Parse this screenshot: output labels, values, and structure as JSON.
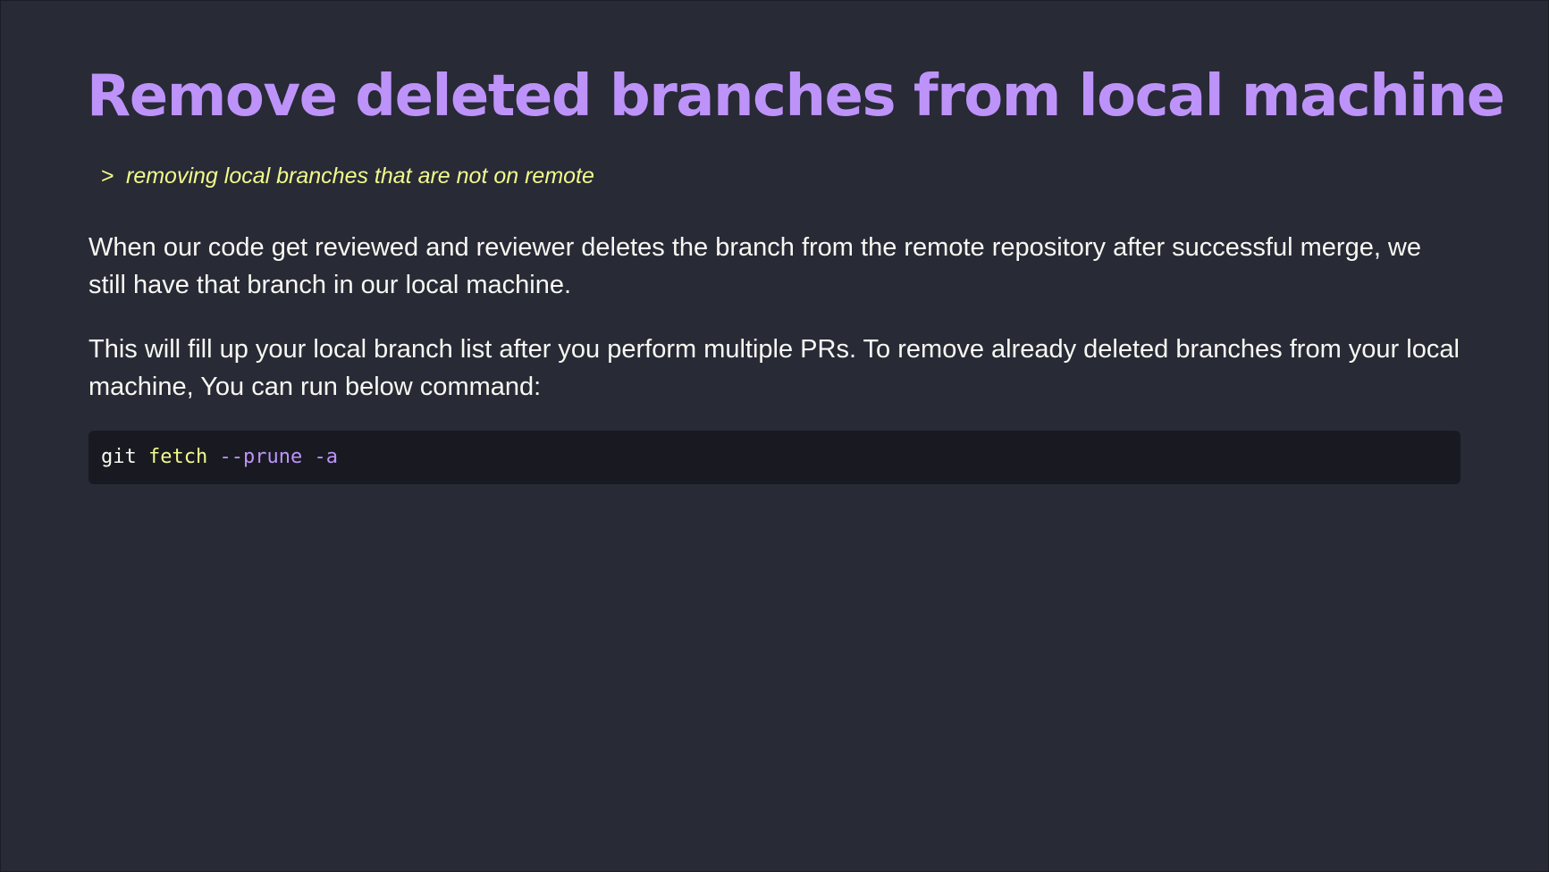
{
  "article": {
    "title": "Remove deleted branches from local machine",
    "subtitle_marker": ">",
    "subtitle": "removing local branches that are not on remote",
    "paragraphs": [
      "When our code get reviewed and reviewer deletes the branch from the remote repository after successful merge, we still have that branch in our local machine.",
      "This will fill up your local branch list after you perform multiple PRs. To remove already deleted branches from your local machine, You can run below command:"
    ],
    "code": {
      "command": "git",
      "subcommand": "fetch",
      "flags": "--prune -a"
    }
  },
  "colors": {
    "background": "#282a36",
    "title": "#bd93f9",
    "subtitle": "#f1fa8c",
    "text": "#f8f8f2",
    "code_background": "#191a21"
  }
}
